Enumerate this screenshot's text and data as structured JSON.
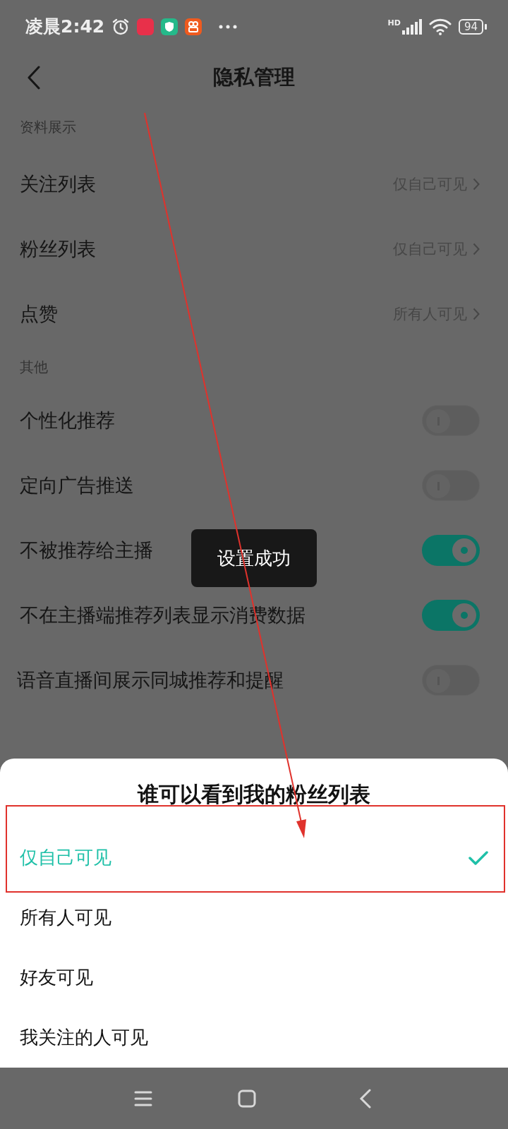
{
  "status_bar": {
    "time": "凌晨2:42",
    "network": "HD",
    "battery": "94"
  },
  "header": {
    "title": "隐私管理"
  },
  "sections": [
    {
      "title": "资料展示",
      "rows": [
        {
          "kind": "link",
          "label": "关注列表",
          "value": "仅自己可见"
        },
        {
          "kind": "link",
          "label": "粉丝列表",
          "value": "仅自己可见"
        },
        {
          "kind": "link",
          "label": "点赞",
          "value": "所有人可见"
        }
      ]
    },
    {
      "title": "其他",
      "rows": [
        {
          "kind": "toggle",
          "label": "个性化推荐",
          "on": false
        },
        {
          "kind": "toggle",
          "label": "定向广告推送",
          "on": false
        },
        {
          "kind": "toggle",
          "label": "不被推荐给主播",
          "on": true
        },
        {
          "kind": "toggle",
          "label": "不在主播端推荐列表显示消费数据",
          "on": true
        },
        {
          "kind": "toggle",
          "label": "语音直播间展示同城推荐和提醒",
          "on": false
        }
      ]
    }
  ],
  "toast": "设置成功",
  "sheet": {
    "title": "谁可以看到我的粉丝列表",
    "options": [
      {
        "label": "仅自己可见",
        "selected": true
      },
      {
        "label": "所有人可见",
        "selected": false
      },
      {
        "label": "好友可见",
        "selected": false
      },
      {
        "label": "我关注的人可见",
        "selected": false
      }
    ]
  }
}
